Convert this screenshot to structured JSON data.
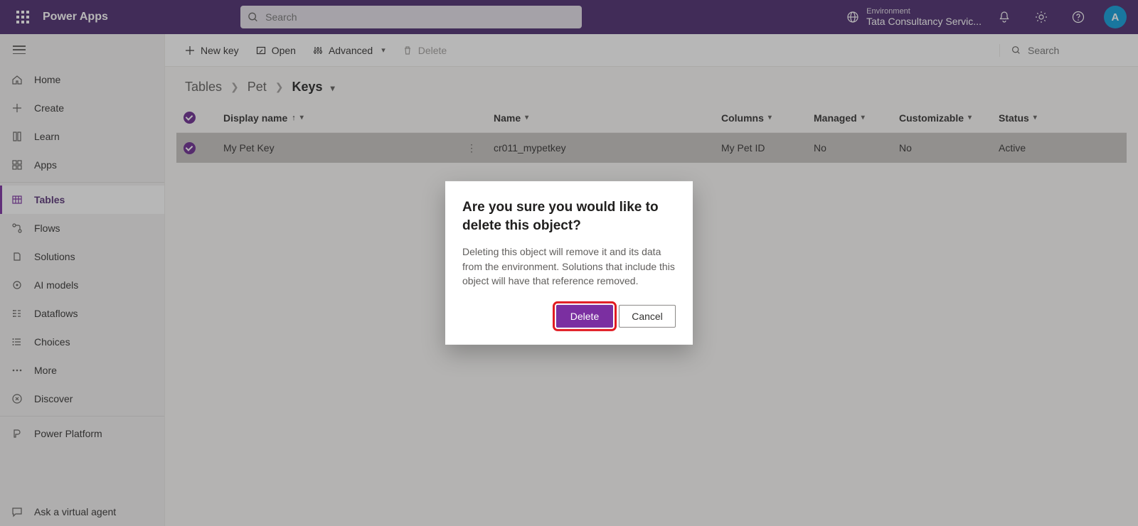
{
  "header": {
    "app_name": "Power Apps",
    "search_placeholder": "Search",
    "environment_label": "Environment",
    "environment_name": "Tata Consultancy Servic...",
    "avatar_initial": "A"
  },
  "sidebar": {
    "items": [
      {
        "label": "Home",
        "active": false
      },
      {
        "label": "Create",
        "active": false
      },
      {
        "label": "Learn",
        "active": false
      },
      {
        "label": "Apps",
        "active": false
      },
      {
        "label": "Tables",
        "active": true
      },
      {
        "label": "Flows",
        "active": false
      },
      {
        "label": "Solutions",
        "active": false
      },
      {
        "label": "AI models",
        "active": false
      },
      {
        "label": "Dataflows",
        "active": false
      },
      {
        "label": "Choices",
        "active": false
      },
      {
        "label": "More",
        "active": false
      },
      {
        "label": "Discover",
        "active": false
      }
    ],
    "power_platform_label": "Power Platform",
    "ask_agent_label": "Ask a virtual agent"
  },
  "commandbar": {
    "new_key": "New key",
    "open": "Open",
    "advanced": "Advanced",
    "delete": "Delete",
    "search_placeholder": "Search"
  },
  "breadcrumbs": {
    "root": "Tables",
    "level2": "Pet",
    "current": "Keys"
  },
  "table": {
    "columns": {
      "display_name": "Display name",
      "name": "Name",
      "columns": "Columns",
      "managed": "Managed",
      "customizable": "Customizable",
      "status": "Status"
    },
    "rows": [
      {
        "selected": true,
        "display_name": "My Pet Key",
        "name": "cr011_mypetkey",
        "columns": "My Pet ID",
        "managed": "No",
        "customizable": "No",
        "status": "Active"
      }
    ]
  },
  "dialog": {
    "title": "Are you sure you would like to delete this object?",
    "body": "Deleting this object will remove it and its data from the environment. Solutions that include this object will have that reference removed.",
    "primary": "Delete",
    "secondary": "Cancel"
  }
}
